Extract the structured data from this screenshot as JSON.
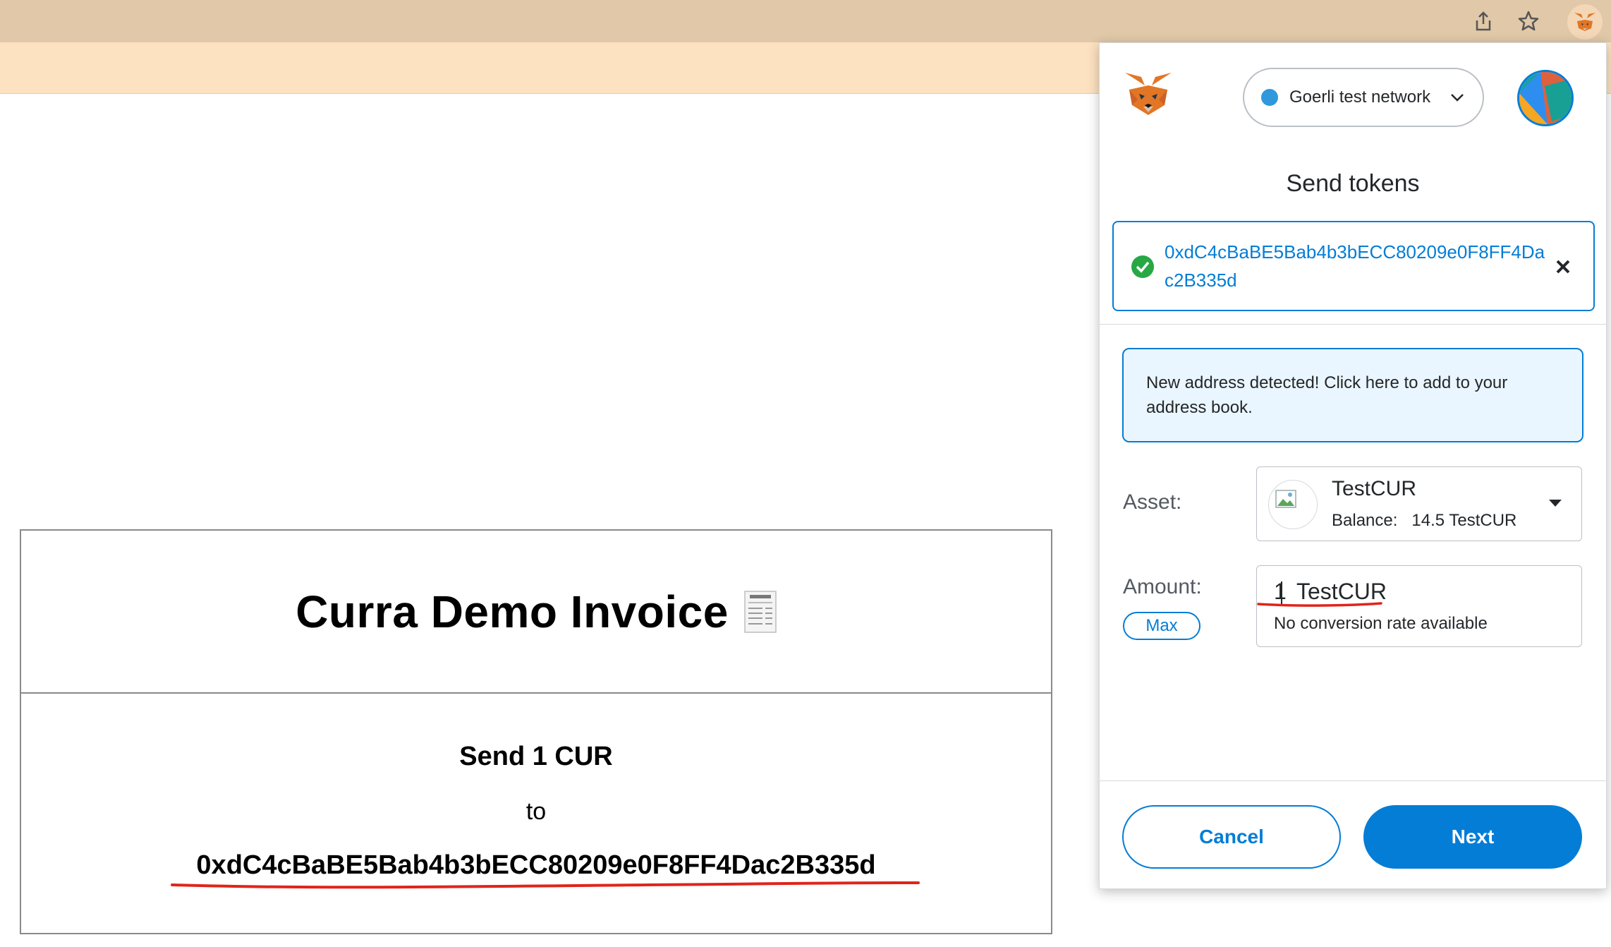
{
  "page": {
    "title": "Curra Demo Invoice",
    "title_icon": "receipt-icon",
    "send_line": "Send 1 CUR",
    "to_line": "to",
    "address": "0xdC4cBaBE5Bab4b3bECC80209e0F8FF4Dac2B335d"
  },
  "browser": {
    "icons": [
      "share-icon",
      "star-icon",
      "metamask-extension-icon"
    ]
  },
  "metamask": {
    "network": "Goerli test network",
    "header": "Send tokens",
    "recipient_address": "0xdC4cBaBE5Bab4b3bECC80209e0F8FF4Dac2B335d",
    "notice": "New address detected! Click here to add to your address book.",
    "asset_label": "Asset:",
    "asset_name": "TestCUR",
    "balance_label": "Balance:",
    "balance_value": "14.5 TestCUR",
    "amount_label": "Amount:",
    "max_label": "Max",
    "amount_value": "1",
    "amount_unit": "TestCUR",
    "conversion_text": "No conversion rate available",
    "cancel_label": "Cancel",
    "next_label": "Next"
  },
  "colors": {
    "accent": "#037dd6",
    "success": "#28a745",
    "underline": "#e0241b",
    "network_dot": "#3098dc"
  }
}
